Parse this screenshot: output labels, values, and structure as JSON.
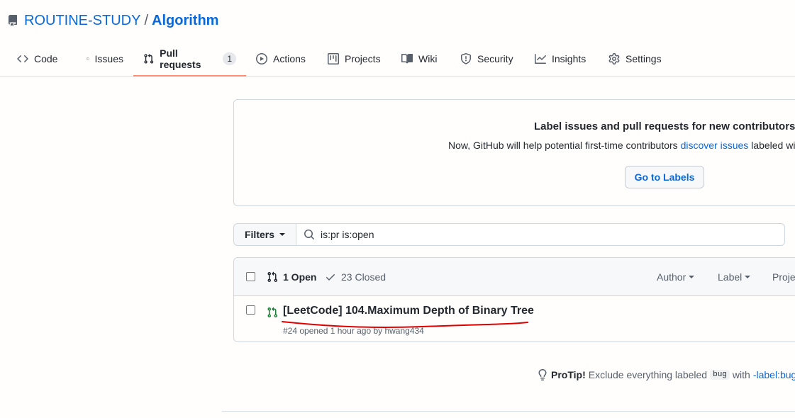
{
  "repo": {
    "owner": "ROUTINE-STUDY",
    "separator": "/",
    "name": "Algorithm"
  },
  "tabs": [
    {
      "label": "Code",
      "icon": "code-icon"
    },
    {
      "label": "Issues",
      "icon": "issue-opened-icon"
    },
    {
      "label": "Pull requests",
      "icon": "git-pull-request-icon",
      "counter": "1",
      "selected": true
    },
    {
      "label": "Actions",
      "icon": "play-icon"
    },
    {
      "label": "Projects",
      "icon": "table-icon"
    },
    {
      "label": "Wiki",
      "icon": "book-icon"
    },
    {
      "label": "Security",
      "icon": "shield-icon"
    },
    {
      "label": "Insights",
      "icon": "graph-icon"
    },
    {
      "label": "Settings",
      "icon": "gear-icon"
    }
  ],
  "blankslate": {
    "title": "Label issues and pull requests for new contributors",
    "text_before": "Now, GitHub will help potential first-time contributors",
    "link": "discover issues",
    "text_after": "labeled with",
    "button": "Go to Labels"
  },
  "filters": {
    "button": "Filters",
    "query": "is:pr is:open"
  },
  "list_header": {
    "open": "1 Open",
    "closed": "23 Closed",
    "author": "Author",
    "label": "Label",
    "projects": "Projects"
  },
  "pull_requests": [
    {
      "title": "[LeetCode] 104.Maximum Depth of Binary Tree",
      "meta": "#24 opened 1 hour ago by hwang434"
    }
  ],
  "protip": {
    "heading": "ProTip!",
    "text_before": "Exclude everything labeled",
    "code": "bug",
    "text_mid": "with",
    "link": "-label:bug",
    "text_after": "."
  },
  "colors": {
    "accent": "#0969da",
    "open_green": "#1a7f37",
    "tab_underline": "#fd8c73",
    "annotation_red": "#e00000"
  }
}
